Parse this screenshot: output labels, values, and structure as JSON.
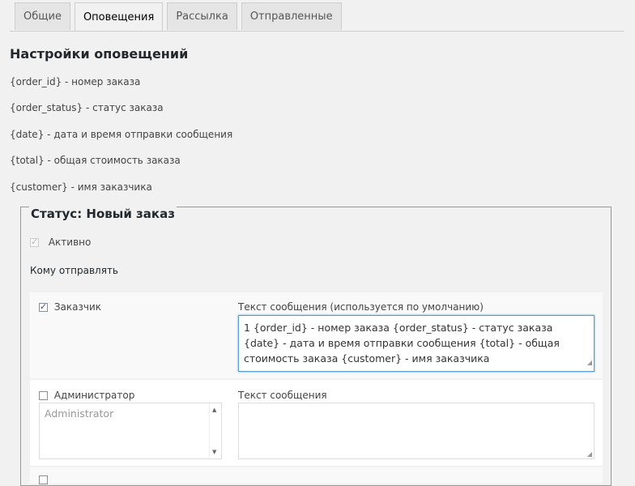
{
  "tabs": [
    "Общие",
    "Оповещения",
    "Рассылка",
    "Отправленные"
  ],
  "heading": "Настройки оповещений",
  "placeholders": [
    "{order_id} - номер заказа",
    "{order_status} - статус заказа",
    "{date} - дата и время отправки сообщения",
    "{total} - общая стоимость заказа",
    "{customer} - имя заказчика"
  ],
  "status_block": {
    "legend": "Статус: Новый заказ",
    "active_label": "Активно",
    "active_checked": true,
    "send_to_label": "Кому отправлять",
    "customer": {
      "label": "Заказчик",
      "checked": true,
      "message_label": "Текст сообщения (используется по умолчанию)",
      "message_value": "1 {order_id} - номер заказа {order_status} - статус заказа {date} - дата и время отправки сообщения {total} - общая стоимость заказа {customer} - имя заказчика"
    },
    "admin": {
      "label": "Администратор",
      "checked": false,
      "select_value": "Administrator",
      "message_label": "Текст сообщения",
      "message_value": ""
    }
  }
}
